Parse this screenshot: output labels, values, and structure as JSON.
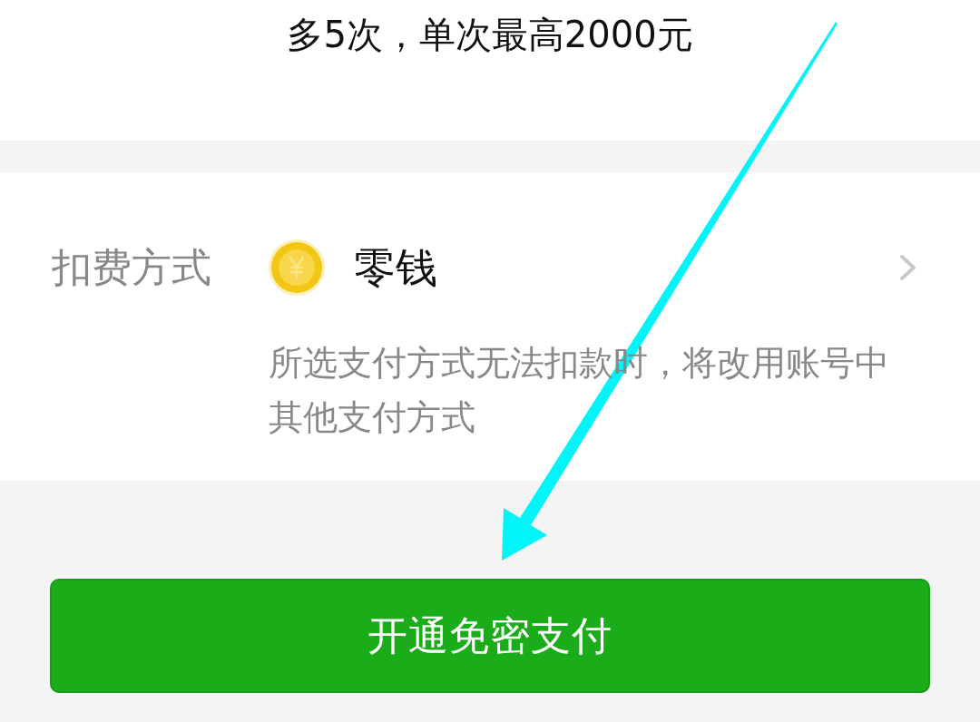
{
  "header": {
    "text": "多5次，单次最高2000元"
  },
  "payment_method": {
    "label": "扣费方式",
    "value": "零钱",
    "note": "所选支付方式无法扣款时，将改用账号中其他支付方式"
  },
  "primary_button": {
    "label": "开通免密支付"
  }
}
